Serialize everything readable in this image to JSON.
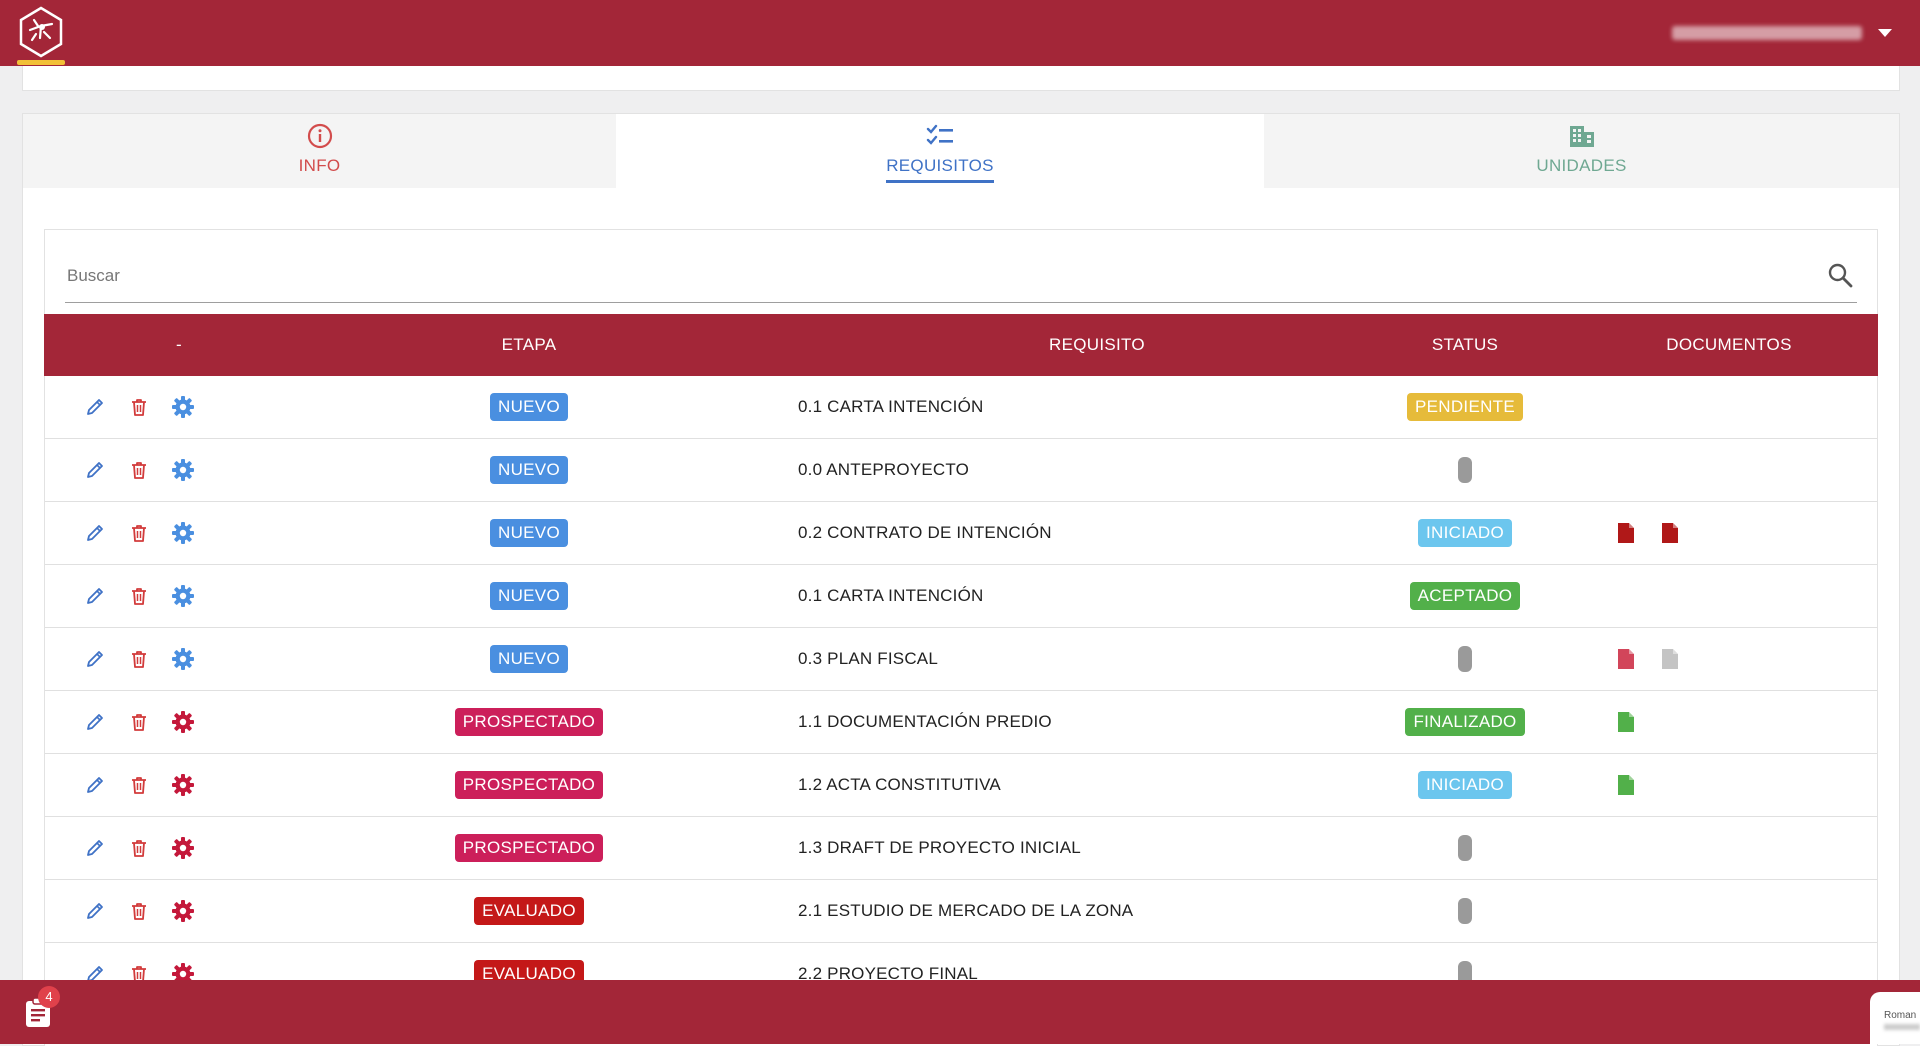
{
  "header": {
    "logo": "insect-hexagon-logo",
    "user_menu_icon": "caret-down-icon"
  },
  "tabs": [
    {
      "label": "INFO",
      "icon": "info-circle-icon",
      "color": "#d24c4c"
    },
    {
      "label": "REQUISITOS",
      "icon": "checklist-icon",
      "color": "#3f72c6",
      "active": true
    },
    {
      "label": "UNIDADES",
      "icon": "building-icon",
      "color": "#6fa892"
    }
  ],
  "search": {
    "placeholder": "Buscar",
    "value": "",
    "icon": "search-icon"
  },
  "table": {
    "headers": {
      "actions": "-",
      "etapa": "ETAPA",
      "requisito": "REQUISITO",
      "status": "STATUS",
      "documentos": "DOCUMENTOS"
    },
    "rows": [
      {
        "etapa": "NUEVO",
        "requisito": "0.1 CARTA INTENCIÓN",
        "status": "PENDIENTE",
        "docs": []
      },
      {
        "etapa": "NUEVO",
        "requisito": "0.0 ANTEPROYECTO",
        "status": "",
        "docs": []
      },
      {
        "etapa": "NUEVO",
        "requisito": "0.2 CONTRATO DE INTENCIÓN",
        "status": "INICIADO",
        "docs": [
          "red",
          "red"
        ]
      },
      {
        "etapa": "NUEVO",
        "requisito": "0.1 CARTA INTENCIÓN",
        "status": "ACEPTADO",
        "docs": []
      },
      {
        "etapa": "NUEVO",
        "requisito": "0.3 PLAN FISCAL",
        "status": "",
        "docs": [
          "pink",
          "grey"
        ]
      },
      {
        "etapa": "PROSPECTADO",
        "requisito": "1.1 DOCUMENTACIÓN PREDIO",
        "status": "FINALIZADO",
        "docs": [
          "green"
        ]
      },
      {
        "etapa": "PROSPECTADO",
        "requisito": "1.2 ACTA CONSTITUTIVA",
        "status": "INICIADO",
        "docs": [
          "green"
        ]
      },
      {
        "etapa": "PROSPECTADO",
        "requisito": "1.3 DRAFT DE PROYECTO INICIAL",
        "status": "",
        "docs": []
      },
      {
        "etapa": "EVALUADO",
        "requisito": "2.1 ESTUDIO DE MERCADO DE LA ZONA",
        "status": "",
        "docs": []
      },
      {
        "etapa": "EVALUADO",
        "requisito": "2.2 PROYECTO FINAL",
        "status": "",
        "docs": []
      }
    ]
  },
  "colors": {
    "brand": "#a32638",
    "etapa": {
      "NUEVO": "#4a8fe0",
      "PROSPECTADO": "#cc1f5a",
      "EVALUADO": "#c41818"
    },
    "status": {
      "PENDIENTE": "#e6bb3a",
      "INICIADO": "#6cc6ee",
      "ACEPTADO": "#52b04a",
      "FINALIZADO": "#52b04a"
    },
    "docs": {
      "red": "#b01818",
      "pink": "#d2455a",
      "grey": "#c4c4c4",
      "green": "#52b04a"
    },
    "gear": {
      "NUEVO": "#4a8fe0",
      "PROSPECTADO": "#c4183a",
      "EVALUADO": "#c4183a"
    }
  },
  "footer": {
    "notifications_count": "4",
    "notifications_icon": "clipboard-icon",
    "chat_label": "Roman"
  }
}
